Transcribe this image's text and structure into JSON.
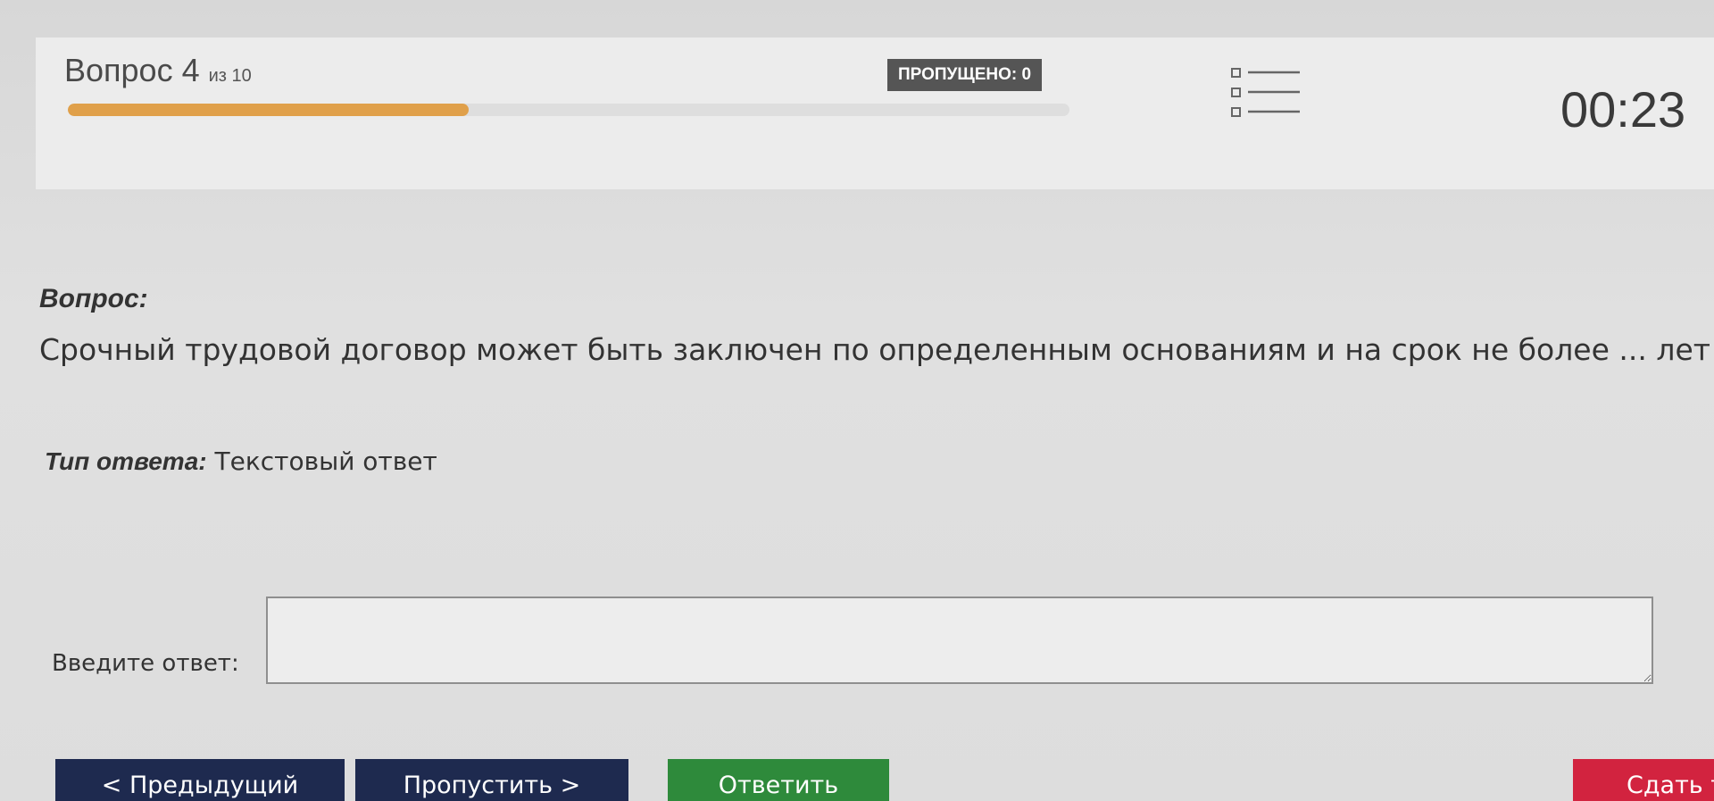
{
  "header": {
    "question_label": "Вопрос 4",
    "question_of": "из 10",
    "progress_fraction": 0.4,
    "skipped_label": "ПРОПУЩЕНО: 0",
    "timer": "00:23"
  },
  "question": {
    "label": "Вопрос:",
    "text": "Срочный трудовой договор может быть заключен по определенным основаниям и на срок не более ... лет"
  },
  "answer_type": {
    "label": "Тип ответа:",
    "value": "Текстовый ответ"
  },
  "answer": {
    "label": "Введите ответ:",
    "value": ""
  },
  "buttons": {
    "prev": "< Предыдущий",
    "skip": "Пропустить >",
    "answer": "Ответить",
    "finish": "Сдать т"
  },
  "colors": {
    "progress": "#e0a04a",
    "nav_button": "#1e2a4f",
    "answer_button": "#2e8a3b",
    "finish_button": "#d2233f"
  },
  "icons": {
    "question_list": "question-list-icon"
  }
}
